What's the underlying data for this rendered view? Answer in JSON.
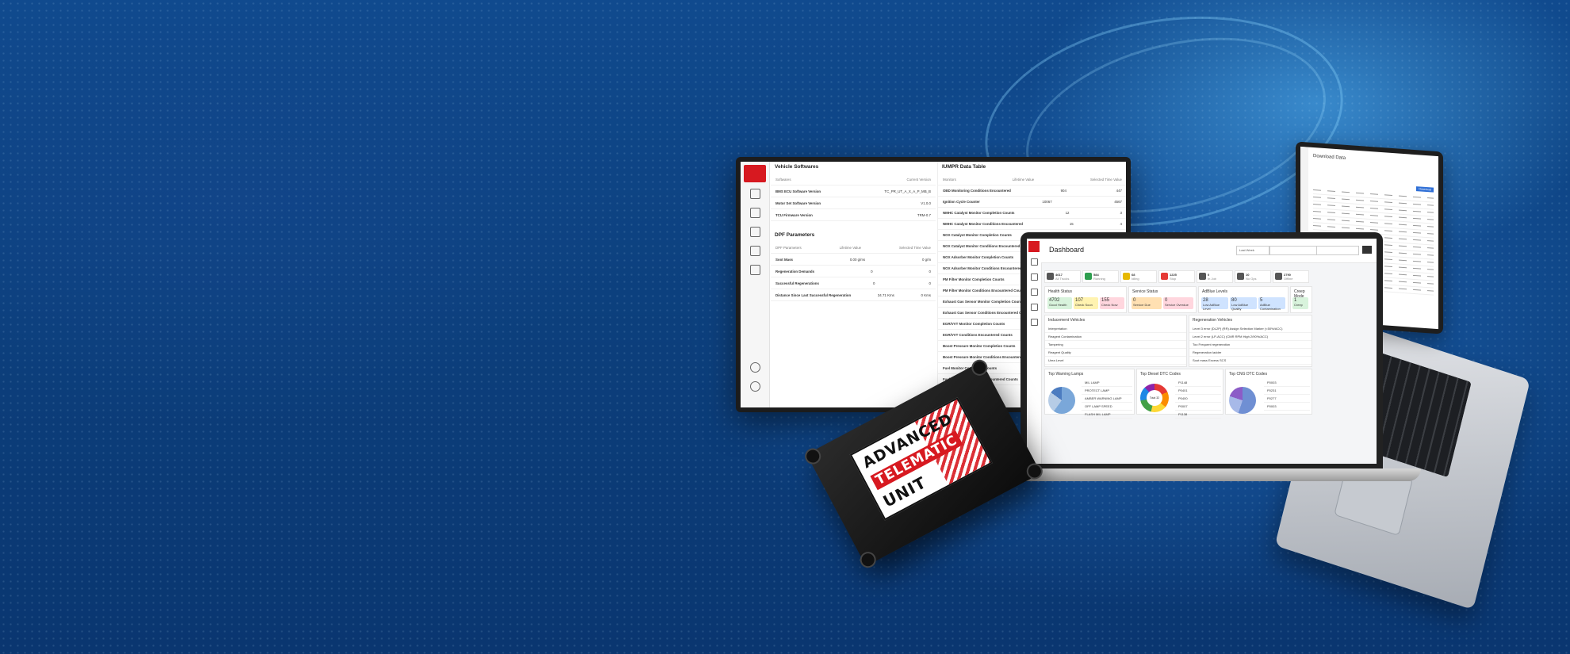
{
  "monitor": {
    "vehicle_softwares": {
      "title": "Vehicle Softwares",
      "header": [
        "Softwares",
        "Current Version"
      ],
      "rows": [
        [
          "BMS ECU Software Version",
          "TC_PR_UT_A_X_A_P_MB_B"
        ],
        [
          "Motor Set Software Version",
          "V1.0.0"
        ],
        [
          "TCU Firmware Version",
          "TRM-0.7"
        ]
      ]
    },
    "dpf_parameters": {
      "title": "DPF Parameters",
      "header": [
        "DPF Parameters",
        "Lifetime Value",
        "Selected Time Value"
      ],
      "rows": [
        [
          "Soot Mass",
          "0.00 g/ms",
          "0 g/m"
        ],
        [
          "Regeneration Demands",
          "0",
          "0"
        ],
        [
          "Successful Regenerations",
          "0",
          "0"
        ],
        [
          "Distance Since Last Successful Regeneration",
          "34.71 Kms",
          "0 Kms"
        ]
      ]
    },
    "iumpr": {
      "title": "IUMPR Data Table",
      "header": [
        "Monitors",
        "Lifetime Value",
        "Selected Time Value"
      ],
      "rows": [
        [
          "OBD Monitoring Conditions Encountered",
          "904",
          "447"
        ],
        [
          "Ignition Cycle Counter",
          "10067",
          "4567"
        ],
        [
          "NMHC Catalyst Monitor Completion Counts",
          "12",
          "3"
        ],
        [
          "NMHC Catalyst Monitor Conditions Encountered",
          "15",
          "4"
        ],
        [
          "NOX Catalyst Monitor Completion Counts",
          "",
          ""
        ],
        [
          "NOX Catalyst Monitor Conditions Encountered Counts",
          "",
          ""
        ],
        [
          "NOX Adsorber Monitor Completion Counts",
          "",
          ""
        ],
        [
          "NOX Adsorber Monitor Conditions Encountered Counts",
          "",
          ""
        ],
        [
          "PM Filter Monitor Completion Counts",
          "",
          ""
        ],
        [
          "PM Filter Monitor Conditions Encountered Counts",
          "",
          ""
        ],
        [
          "Exhaust Gas Sensor Monitor Completion Counts",
          "",
          ""
        ],
        [
          "Exhaust Gas Sensor Conditions Encountered Counts",
          "",
          ""
        ],
        [
          "EGR/VVT Monitor Completion Counts",
          "",
          ""
        ],
        [
          "EGR/VVT Conditions Encountered Counts",
          "",
          ""
        ],
        [
          "Boost Pressure Monitor Completion Counts",
          "",
          ""
        ],
        [
          "Boost Pressure Monitor Conditions Encountered Counts",
          "",
          ""
        ],
        [
          "Fuel Monitor Completion Counts",
          "",
          ""
        ],
        [
          "Fuel Monitor Conditions Encountered Counts",
          "",
          ""
        ]
      ]
    }
  },
  "laptop": {
    "title": "Dashboard",
    "filter_label": "Last Week",
    "kpis": [
      {
        "value": "4617",
        "label": "All Trucks",
        "color": "#555555"
      },
      {
        "value": "584",
        "label": "Running",
        "color": "#2e9e4f"
      },
      {
        "value": "68",
        "label": "Idling",
        "color": "#e6b800"
      },
      {
        "value": "1225",
        "label": "Stop",
        "color": "#e53935"
      },
      {
        "value": "0",
        "label": "In Job",
        "color": "#555555"
      },
      {
        "value": "10",
        "label": "No Gps",
        "color": "#555555"
      },
      {
        "value": "2790",
        "label": "Offline",
        "color": "#555555"
      }
    ],
    "health_status": {
      "title": "Health Status",
      "pills": [
        {
          "value": "4702",
          "label": "Good Health",
          "color": "#d8f3dc"
        },
        {
          "value": "107",
          "label": "Check Soon",
          "color": "#fff3b0"
        },
        {
          "value": "155",
          "label": "Check Now",
          "color": "#ffd6de"
        }
      ]
    },
    "service_status": {
      "title": "Service Status",
      "pills": [
        {
          "value": "0",
          "label": "Service Due",
          "color": "#ffe0b2"
        },
        {
          "value": "0",
          "label": "Service Overdue",
          "color": "#ffd6de"
        }
      ]
    },
    "adblue_levels": {
      "title": "AdBlue Levels",
      "pills": [
        {
          "value": "28",
          "label": "Low AdBlue Level",
          "color": "#cfe3ff"
        },
        {
          "value": "80",
          "label": "Low AdBlue Quality",
          "color": "#cfe3ff"
        },
        {
          "value": "5",
          "label": "AdBlue Contamination",
          "color": "#cfe3ff"
        }
      ]
    },
    "creep_mode": {
      "title": "Creep Mode",
      "value": "1",
      "label": "Creep"
    },
    "inducement": {
      "title": "Inducement Vehicles",
      "rows": [
        "Interpretation",
        "Reagent Contamination",
        "Tampering",
        "Reagent Quality",
        "Urea Level"
      ]
    },
    "regeneration": {
      "title": "Regeneration Vehicles",
      "rows": [
        "Level 3 error (DL2P) (RR) Assign Selection Marker (<50%/ACC)",
        "Level 2 error (LP-ACC) (CMR RPM High 2/90%/ACC)",
        "Too Frequent regeneration",
        "Regeneration ladder",
        "Soot mass Excess SCS"
      ]
    },
    "top_warning": {
      "title": "Top Warning Lamps",
      "items": [
        "MIL LAMP",
        "PROTECT LAMP",
        "AMBER WARNING LAMP",
        "OFF LAMP SPEED",
        "FLASH MIL LAMP"
      ]
    },
    "top_diesel": {
      "title": "Top Diesel DTC Codes",
      "center": "Total 32",
      "items": [
        "P1148",
        "P0401",
        "P0400",
        "P0007",
        "P1138"
      ]
    },
    "top_cng": {
      "title": "Top CNG DTC Codes",
      "items": [
        "P0003",
        "P0231",
        "P0277",
        "P0003"
      ]
    }
  },
  "kb_laptop": {
    "title": "Download Data",
    "download_label": "Download"
  },
  "device": {
    "line1": "ADVANCED",
    "line2": "TELEMATIC",
    "line3": "UNIT"
  }
}
